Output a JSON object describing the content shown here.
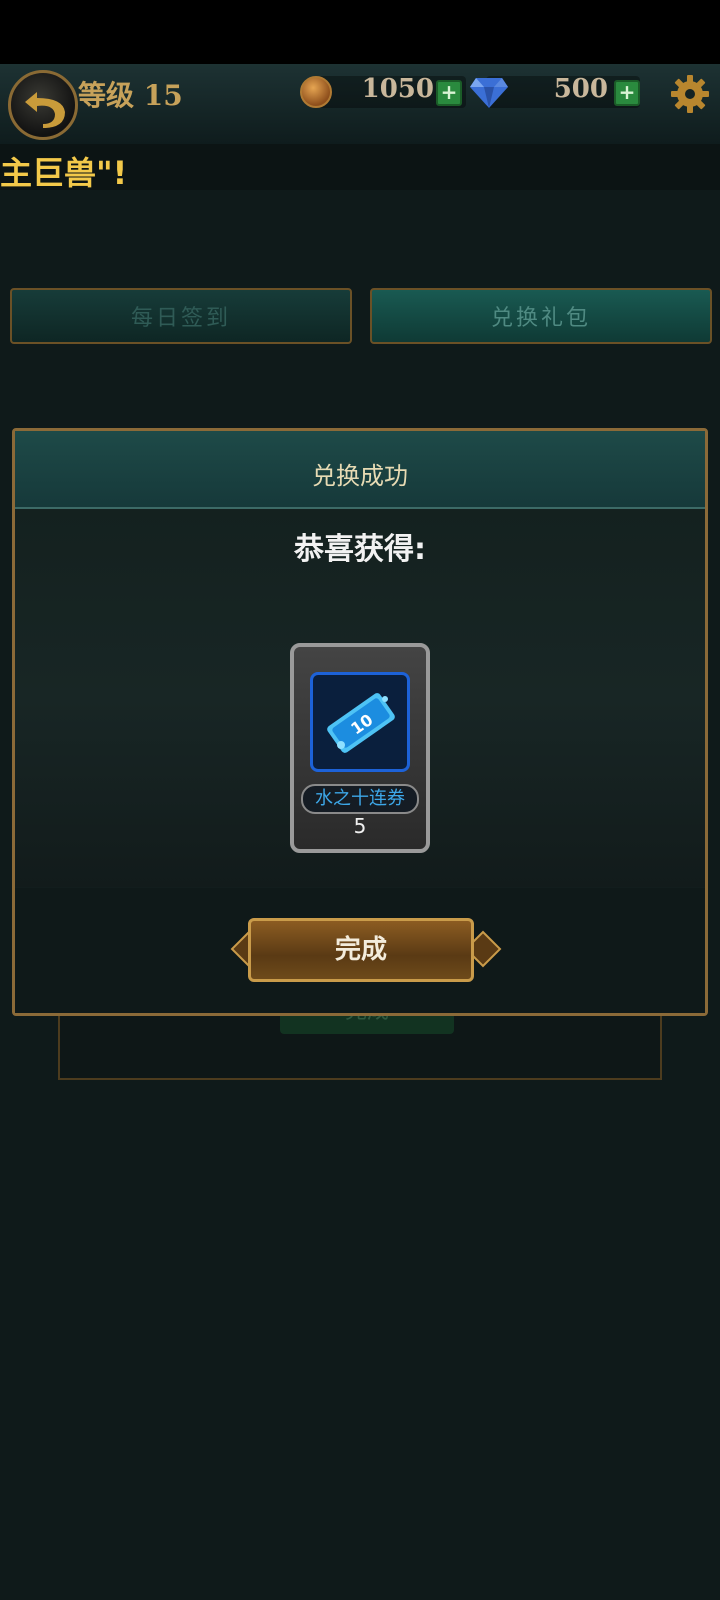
{
  "header": {
    "level_label": "等级 15",
    "gold": "1050",
    "diamonds": "500",
    "plus": "+"
  },
  "marquee": {
    "text": "主巨兽\"!"
  },
  "tabs": [
    {
      "label": "每日签到"
    },
    {
      "label": "兑换礼包"
    }
  ],
  "background_panel": {
    "button_label": "完成"
  },
  "dialog": {
    "title": "兑换成功",
    "congrats": "恭喜获得:",
    "item": {
      "name": "水之十连券",
      "count": "5",
      "icon": "water-ten-pull-ticket-icon"
    },
    "done_label": "完成"
  },
  "colors": {
    "gold_text": "#f3c94a",
    "item_name": "#3da7e8",
    "accent_border": "#8b6a38"
  }
}
